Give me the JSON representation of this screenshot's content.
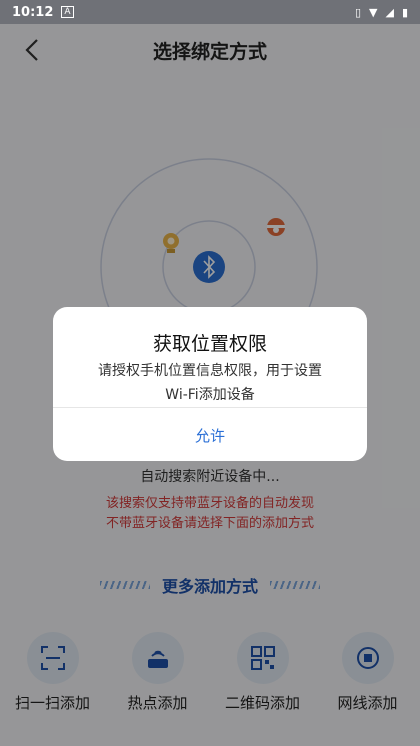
{
  "status_bar": {
    "time": "10:12",
    "app_icon": "A"
  },
  "header": {
    "title": "选择绑定方式"
  },
  "radar": {
    "center_icon": "bluetooth-icon"
  },
  "search": {
    "status": "自动搜索附近设备中...",
    "warning_line1": "该搜索仅支持带蓝牙设备的自动发现",
    "warning_line2": "不带蓝牙设备请选择下面的添加方式"
  },
  "more": {
    "label": "更多添加方式"
  },
  "methods": [
    {
      "label": "扫一扫添加",
      "icon": "scan-icon"
    },
    {
      "label": "热点添加",
      "icon": "hotspot-icon"
    },
    {
      "label": "二维码添加",
      "icon": "qr-code-icon"
    },
    {
      "label": "网线添加",
      "icon": "ethernet-icon"
    }
  ],
  "dialog": {
    "title": "获取位置权限",
    "message_line1": "请授权手机位置信息权限，用于设置",
    "message_line2": "Wi-Fi添加设备",
    "allow_label": "允许"
  },
  "colors": {
    "accent": "#2a6fd6",
    "warning": "#d23b3b",
    "brand_blue": "#1d4fa8"
  }
}
